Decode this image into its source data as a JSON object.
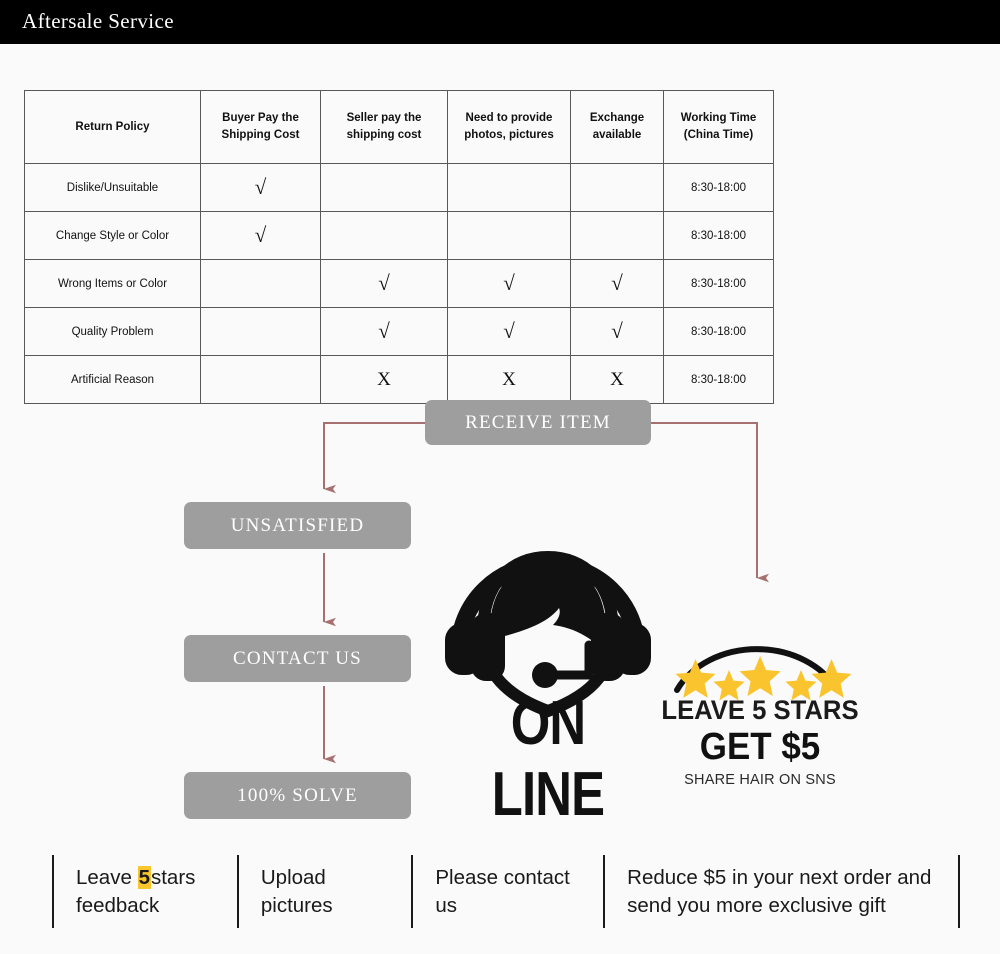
{
  "header": {
    "title": "Aftersale Service"
  },
  "table": {
    "name": "return-policy-table",
    "columns": [
      "Return Policy",
      "Buyer Pay the Shipping Cost",
      "Seller pay the shipping cost",
      "Need to provide photos, pictures",
      "Exchange available",
      "Working Time (China Time)"
    ],
    "columns_lines": [
      [
        "Return Policy"
      ],
      [
        "Buyer Pay the",
        "Shipping Cost"
      ],
      [
        "Seller pay the",
        "shipping cost"
      ],
      [
        "Need to provide",
        "photos, pictures"
      ],
      [
        "Exchange",
        "available"
      ],
      [
        "Working Time",
        "(China Time)"
      ]
    ],
    "check_symbol": "√",
    "cross_symbol": "X",
    "rows": [
      {
        "reason": "Dislike/Unsuitable",
        "buyer_pay": "√",
        "seller_pay": "",
        "photos": "",
        "exchange": "",
        "working_time": "8:30-18:00"
      },
      {
        "reason": "Change Style or Color",
        "buyer_pay": "√",
        "seller_pay": "",
        "photos": "",
        "exchange": "",
        "working_time": "8:30-18:00"
      },
      {
        "reason": "Wrong Items or Color",
        "buyer_pay": "",
        "seller_pay": "√",
        "photos": "√",
        "exchange": "√",
        "working_time": "8:30-18:00"
      },
      {
        "reason": "Quality Problem",
        "buyer_pay": "",
        "seller_pay": "√",
        "photos": "√",
        "exchange": "√",
        "working_time": "8:30-18:00"
      },
      {
        "reason": "Artificial Reason",
        "buyer_pay": "",
        "seller_pay": "X",
        "photos": "X",
        "exchange": "X",
        "working_time": "8:30-18:00"
      }
    ]
  },
  "flow": {
    "receive": "RECEIVE ITEM",
    "unsatisfied": "UNSATISFIED",
    "contact": "CONTACT US",
    "solve": "100% SOLVE",
    "box_color": "#9e9e9e",
    "arrow_color": "#a77070"
  },
  "online": {
    "label": "ON LINE",
    "icon": "headset-agent-icon"
  },
  "stars": {
    "count": 5,
    "star_color": "#f9c42e",
    "leave_line": "LEAVE 5 STARS",
    "get_line": "GET $5",
    "share_line": "SHARE HAIR ON SNS"
  },
  "bottom_bar": {
    "cells": [
      {
        "pre": "Leave ",
        "highlight": "5",
        "post": "stars feedback"
      },
      {
        "text": "Upload pictures"
      },
      {
        "text": "Please contact us"
      },
      {
        "text": "Reduce $5 in your next order and send you more exclusive gift"
      }
    ],
    "highlight_color": "#f9c62e"
  }
}
